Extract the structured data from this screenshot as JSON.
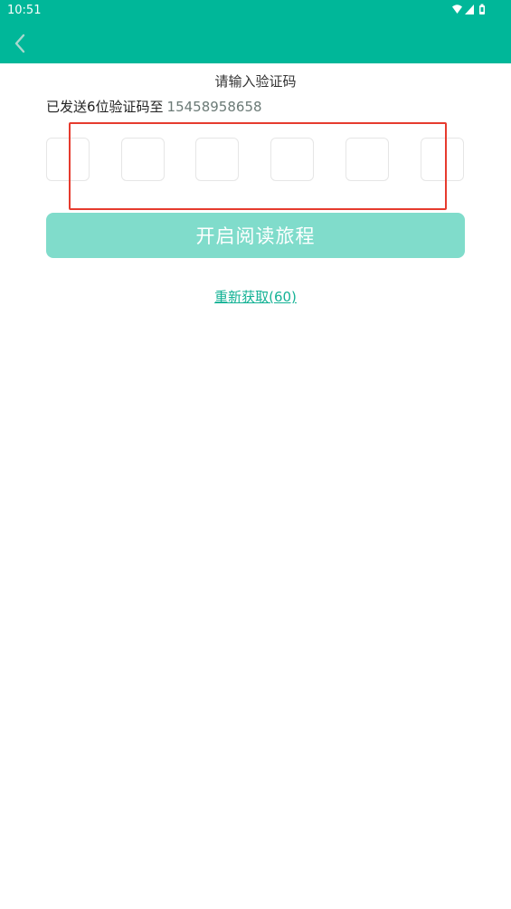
{
  "status_bar": {
    "time": "10:51",
    "icons": [
      "wifi-icon",
      "signal-icon",
      "battery-icon"
    ]
  },
  "header": {
    "back_icon": "chevron-left-icon",
    "background_color": "#00b799"
  },
  "main": {
    "title": "请输入验证码",
    "sent_prefix": "已发送6位验证码至",
    "phone_number": "15458958658",
    "code_boxes": [
      "",
      "",
      "",
      "",
      "",
      ""
    ],
    "start_button_label": "开启阅读旅程",
    "resend_label": "重新获取(60)",
    "accent_color": "#14b295",
    "button_color": "#80dccb"
  }
}
